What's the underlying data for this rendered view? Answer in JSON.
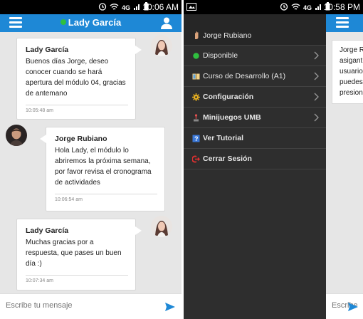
{
  "left": {
    "status": {
      "time": "10:06 AM"
    },
    "header": {
      "title": "Lady García",
      "online_color": "#2fbf3f",
      "bar_color": "#1e88d6"
    },
    "messages": [
      {
        "sender": "Lady García",
        "text": "Buenos días Jorge, deseo conocer cuando se hará apertura del módulo 04, gracias de antemano",
        "time": "10:05:48 am",
        "side": "right"
      },
      {
        "sender": "Jorge Rubiano",
        "text": "Hola Lady, el módulo lo abriremos la próxima semana, por favor revisa el cronograma de actividades",
        "time": "10:06:54 am",
        "side": "left"
      },
      {
        "sender": "Lady García",
        "text": "Muchas gracias por a respuesta, que pases un buen día :)",
        "time": "10:07:34 am",
        "side": "right"
      }
    ],
    "composer": {
      "placeholder": "Escribe tu mensaje"
    }
  },
  "right": {
    "status": {
      "time": "10:58 PM"
    },
    "drawer": {
      "profile": {
        "name": "Jorge Rubiano",
        "icon": "hand-icon"
      },
      "items": [
        {
          "label": "Disponible",
          "icon": "green-dot-icon",
          "bold": false,
          "chevron": true
        },
        {
          "label": "Curso de Desarrollo (A1)",
          "icon": "book-icon",
          "bold": false,
          "chevron": true
        },
        {
          "label": "Configuración",
          "icon": "gear-icon",
          "bold": true,
          "chevron": true
        },
        {
          "label": "Minijuegos UMB",
          "icon": "joystick-icon",
          "bold": true,
          "chevron": true
        },
        {
          "label": "Ver Tutorial",
          "icon": "help-icon",
          "bold": true,
          "chevron": false
        },
        {
          "label": "Cerrar Sesión",
          "icon": "logout-icon",
          "bold": true,
          "chevron": false
        }
      ]
    },
    "peek": {
      "lines": [
        "Jorge R",
        "asigant",
        "usuario",
        "puedes",
        "presion"
      ],
      "placeholder": "Escribe"
    }
  }
}
